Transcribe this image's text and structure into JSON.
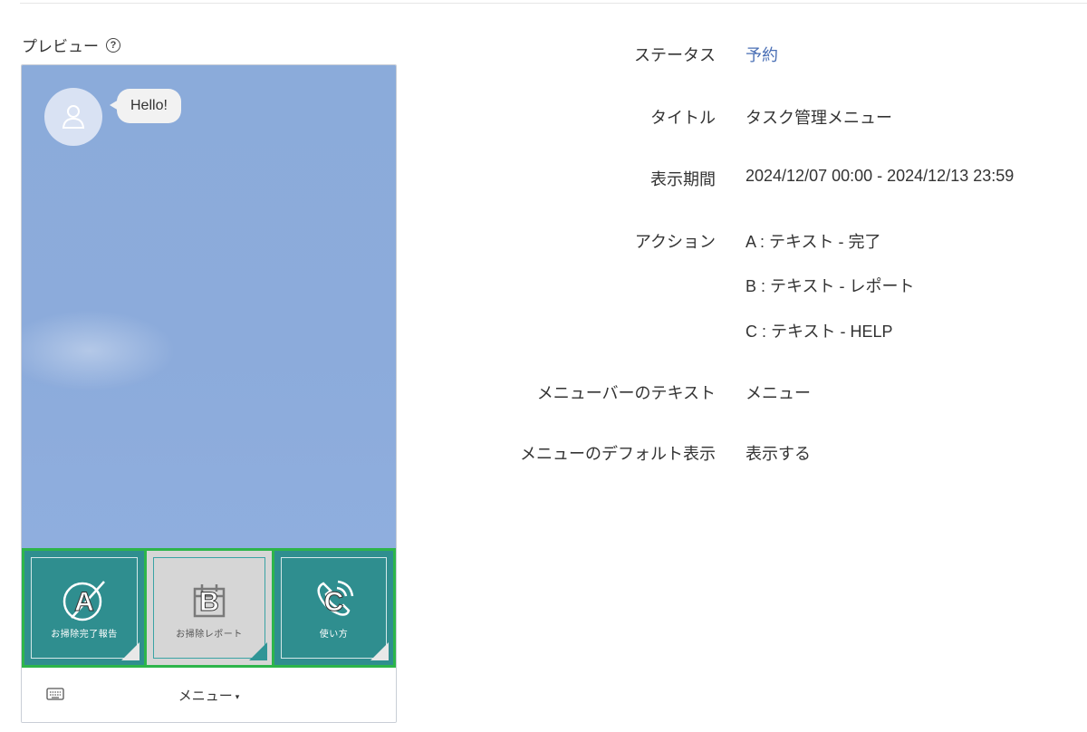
{
  "preview": {
    "title": "プレビュー",
    "help_icon": "?",
    "bubble_text": "Hello!",
    "cells": [
      {
        "letter": "A",
        "label": "お掃除完了報告",
        "icon": "broom-icon"
      },
      {
        "letter": "B",
        "label": "お掃除レポート",
        "icon": "calendar-icon"
      },
      {
        "letter": "C",
        "label": "使い方",
        "icon": "phone-icon"
      }
    ],
    "menu_bar_label": "メニュー",
    "menu_caret": "▾"
  },
  "details": {
    "status": {
      "label": "ステータス",
      "value": "予約"
    },
    "title": {
      "label": "タイトル",
      "value": "タスク管理メニュー"
    },
    "period": {
      "label": "表示期間",
      "value": "2024/12/07 00:00 - 2024/12/13 23:59"
    },
    "actions": {
      "label": "アクション",
      "items": [
        "A : テキスト - 完了",
        "B : テキスト - レポート",
        "C : テキスト - HELP"
      ]
    },
    "menubar_text": {
      "label": "メニューバーのテキスト",
      "value": "メニュー"
    },
    "default_display": {
      "label": "メニューのデフォルト表示",
      "value": "表示する"
    }
  },
  "colors": {
    "status_accent": "#4a6fb5",
    "chat_background": "#8babda",
    "tile_teal": "#2f8e8f",
    "tile_border_green": "#2db54a"
  }
}
